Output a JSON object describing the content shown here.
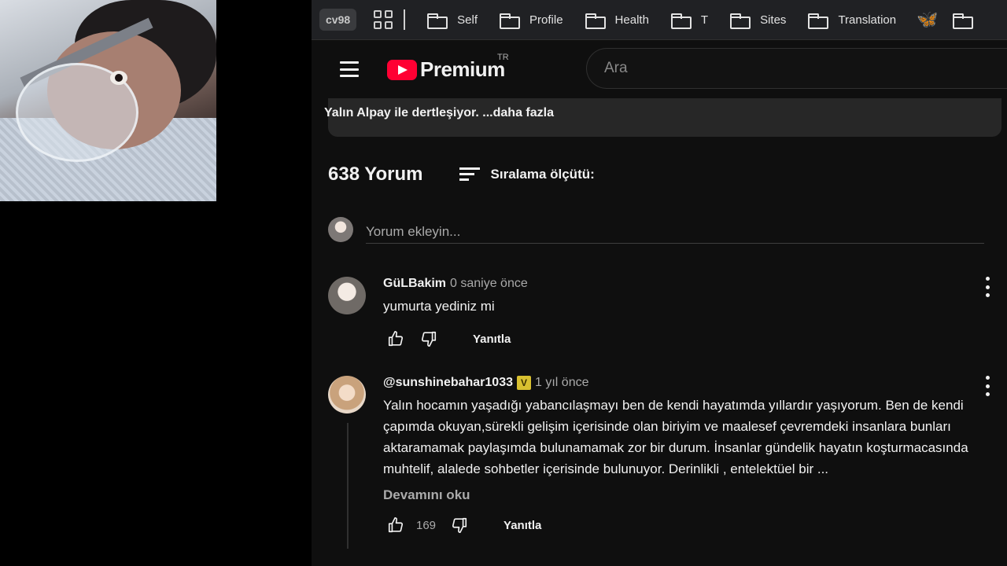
{
  "bookmarks_bar": {
    "profile": "cv98",
    "folders": [
      "Self",
      "Profile",
      "Health",
      "T",
      "Sites",
      "Translation"
    ]
  },
  "masthead": {
    "logo_text": "Premium",
    "country": "TR",
    "search_placeholder": "Ara"
  },
  "description": {
    "text": "Yalın Alpay ile dertleşiyor.",
    "more": "...daha fazla"
  },
  "comments": {
    "count_label": "638 Yorum",
    "sort_label": "Sıralama ölçütü:",
    "add_placeholder": "Yorum ekleyin...",
    "items": [
      {
        "author": "GüLBakim",
        "time": "0 saniye önce",
        "text": "yumurta yediniz mi",
        "likes": "",
        "reply": "Yanıtla"
      },
      {
        "author": "@sunshinebahar1033",
        "time": "1 yıl önce",
        "text": "Yalın hocamın yaşadığı yabancılaşmayı ben de kendi hayatımda yıllardır yaşıyorum. Ben de kendi çapımda okuyan,sürekli gelişim içerisinde olan biriyim ve maalesef çevremdeki insanlara bunları aktaramamak paylaşımda bulunamamak zor bir durum. İnsanlar gündelik hayatın koşturmacasında muhtelif, alalede sohbetler içerisinde bulunuyor. Derinlikli , entelektüel bir ...",
        "more": "Devamını oku",
        "likes": "169",
        "reply": "Yanıtla"
      }
    ]
  },
  "colors": {
    "yt_red": "#ff0033",
    "background": "#0f0f0f",
    "bluesky": "#3b82f6"
  }
}
